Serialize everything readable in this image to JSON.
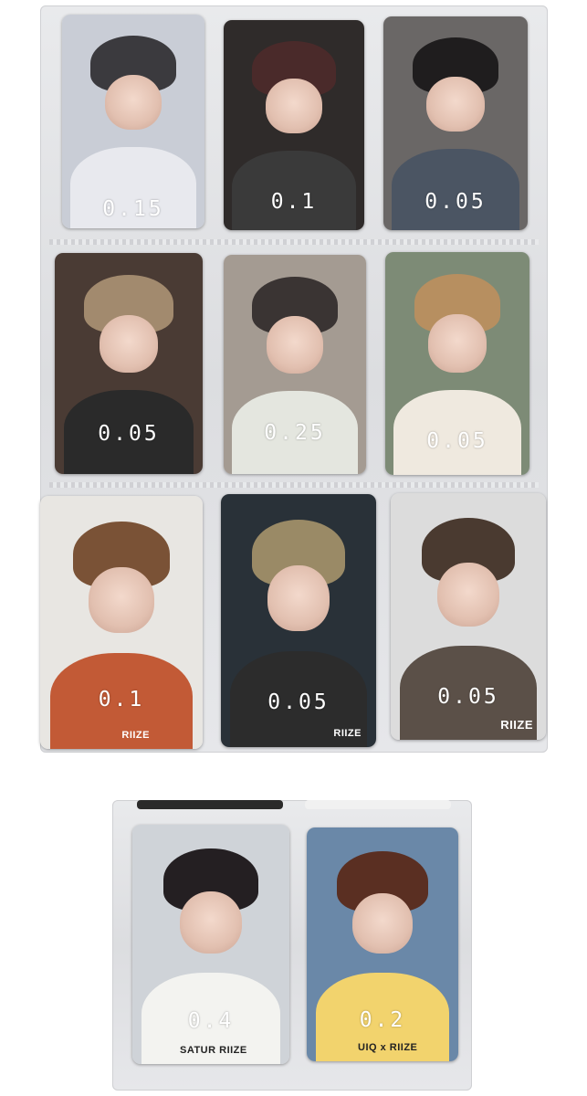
{
  "cards": [
    {
      "price": "0.15",
      "bg": "#c9cdd6",
      "hair": "#3b3a3e",
      "body": "#e8e9ee",
      "brand": ""
    },
    {
      "price": "0.1",
      "bg": "#2f2b2a",
      "hair": "#4a2a2a",
      "body": "#3a3a3a",
      "brand": ""
    },
    {
      "price": "0.05",
      "bg": "#6a6766",
      "hair": "#1f1d1e",
      "body": "#4b5563",
      "brand": ""
    },
    {
      "price": "0.05",
      "bg": "#4a3b34",
      "hair": "#a28a6e",
      "body": "#2a2a2a",
      "brand": ""
    },
    {
      "price": "0.25",
      "bg": "#a49b92",
      "hair": "#3a3433",
      "body": "#e4e6df",
      "brand": ""
    },
    {
      "price": "0.05",
      "bg": "#7d8b76",
      "hair": "#b78f60",
      "body": "#efe9df",
      "brand": ""
    },
    {
      "price": "0.1",
      "bg": "#e8e6e2",
      "hair": "#7a5236",
      "body": "#c25a36",
      "brand": "RIIZE"
    },
    {
      "price": "0.05",
      "bg": "#293138",
      "hair": "#9a8a66",
      "body": "#2c2c2c",
      "brand": "RIIZE"
    },
    {
      "price": "0.05",
      "bg": "#dcdcdc",
      "hair": "#4a3a30",
      "body": "#5b5048",
      "brand": "RIIZE"
    },
    {
      "price": "0.4",
      "bg": "#cfd3d8",
      "hair": "#241f22",
      "body": "#f3f3f0",
      "brand": "SATUR RIIZE"
    },
    {
      "price": "0.2",
      "bg": "#6a88a8",
      "hair": "#5a2f22",
      "body": "#f2d36d",
      "brand": "UIQ x RIIZE"
    }
  ]
}
